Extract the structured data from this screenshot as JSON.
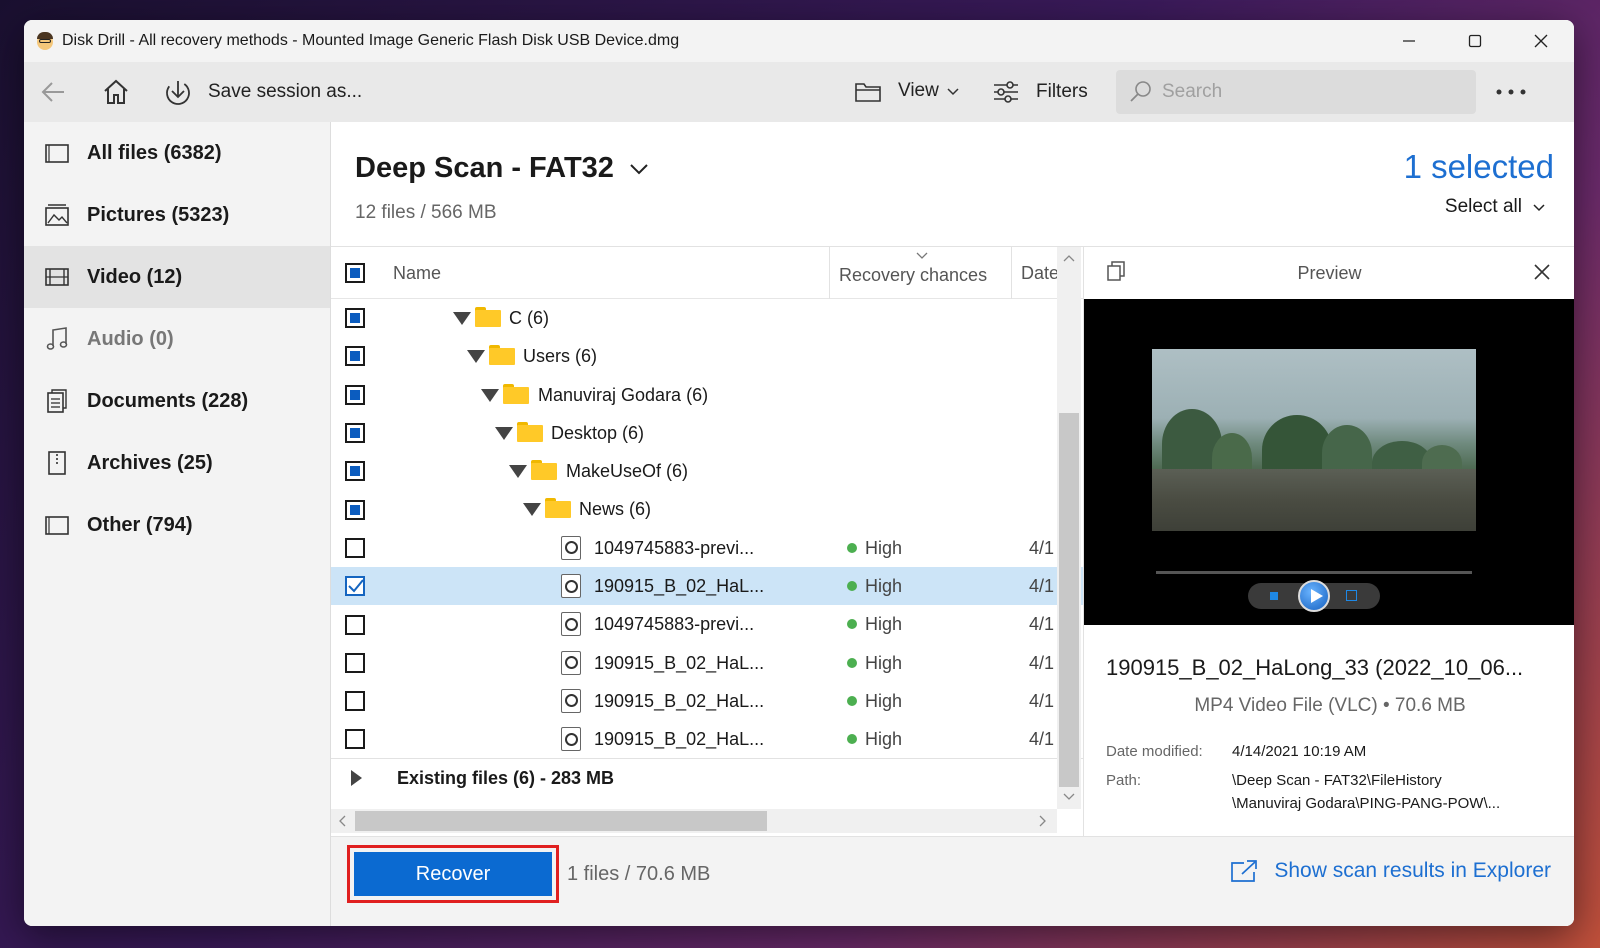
{
  "window": {
    "title": "Disk Drill - All recovery methods - Mounted Image Generic Flash Disk USB Device.dmg"
  },
  "toolbar": {
    "save_session_label": "Save session as...",
    "view_label": "View",
    "filters_label": "Filters",
    "search_placeholder": "Search"
  },
  "sidebar": {
    "items": [
      {
        "label": "All files (6382)",
        "icon": "all-files-icon",
        "active": false
      },
      {
        "label": "Pictures (5323)",
        "icon": "pictures-icon",
        "active": false
      },
      {
        "label": "Video (12)",
        "icon": "video-icon",
        "active": true
      },
      {
        "label": "Audio (0)",
        "icon": "audio-icon",
        "active": false
      },
      {
        "label": "Documents (228)",
        "icon": "documents-icon",
        "active": false
      },
      {
        "label": "Archives (25)",
        "icon": "archives-icon",
        "active": false
      },
      {
        "label": "Other (794)",
        "icon": "other-icon",
        "active": false
      }
    ]
  },
  "scan": {
    "title": "Deep Scan - FAT32",
    "subtitle": "12 files / 566 MB",
    "selected_count": "1 selected",
    "select_all_label": "Select all"
  },
  "table": {
    "columns": [
      "Name",
      "Recovery chances",
      "Date"
    ],
    "folders": [
      {
        "name": "C (6)"
      },
      {
        "name": "Users (6)"
      },
      {
        "name": "Manuviraj Godara (6)"
      },
      {
        "name": "Desktop (6)"
      },
      {
        "name": "MakeUseOf (6)"
      },
      {
        "name": "News (6)"
      }
    ],
    "files": [
      {
        "name": "1049745883-previ...",
        "chance": "High",
        "date": "4/1",
        "checked": false
      },
      {
        "name": "190915_B_02_HaL...",
        "chance": "High",
        "date": "4/1",
        "checked": true
      },
      {
        "name": "1049745883-previ...",
        "chance": "High",
        "date": "4/1",
        "checked": false
      },
      {
        "name": "190915_B_02_HaL...",
        "chance": "High",
        "date": "4/1",
        "checked": false
      },
      {
        "name": "190915_B_02_HaL...",
        "chance": "High",
        "date": "4/1",
        "checked": false
      },
      {
        "name": "190915_B_02_HaL...",
        "chance": "High",
        "date": "4/1",
        "checked": false
      }
    ],
    "existing_files_label": "Existing files (6) - 283 MB"
  },
  "preview": {
    "header": "Preview",
    "file_name": "190915_B_02_HaLong_33 (2022_10_06...",
    "file_type": "MP4 Video File (VLC) • 70.6 MB",
    "date_label": "Date modified:",
    "date_value": "4/14/2021 10:19 AM",
    "path_label": "Path:",
    "path_line1": "\\Deep Scan - FAT32\\FileHistory",
    "path_line2": "\\Manuviraj Godara\\PING-PANG-POW\\..."
  },
  "bottom": {
    "recover_label": "Recover",
    "info": "1 files / 70.6 MB",
    "explorer_link": "Show scan results in Explorer"
  },
  "colors": {
    "accent": "#1d6fd1",
    "recover_button": "#0b6ad1",
    "highlight_border": "#e02020",
    "chance_high": "#4caf50",
    "selected_row": "#cce4f7"
  }
}
